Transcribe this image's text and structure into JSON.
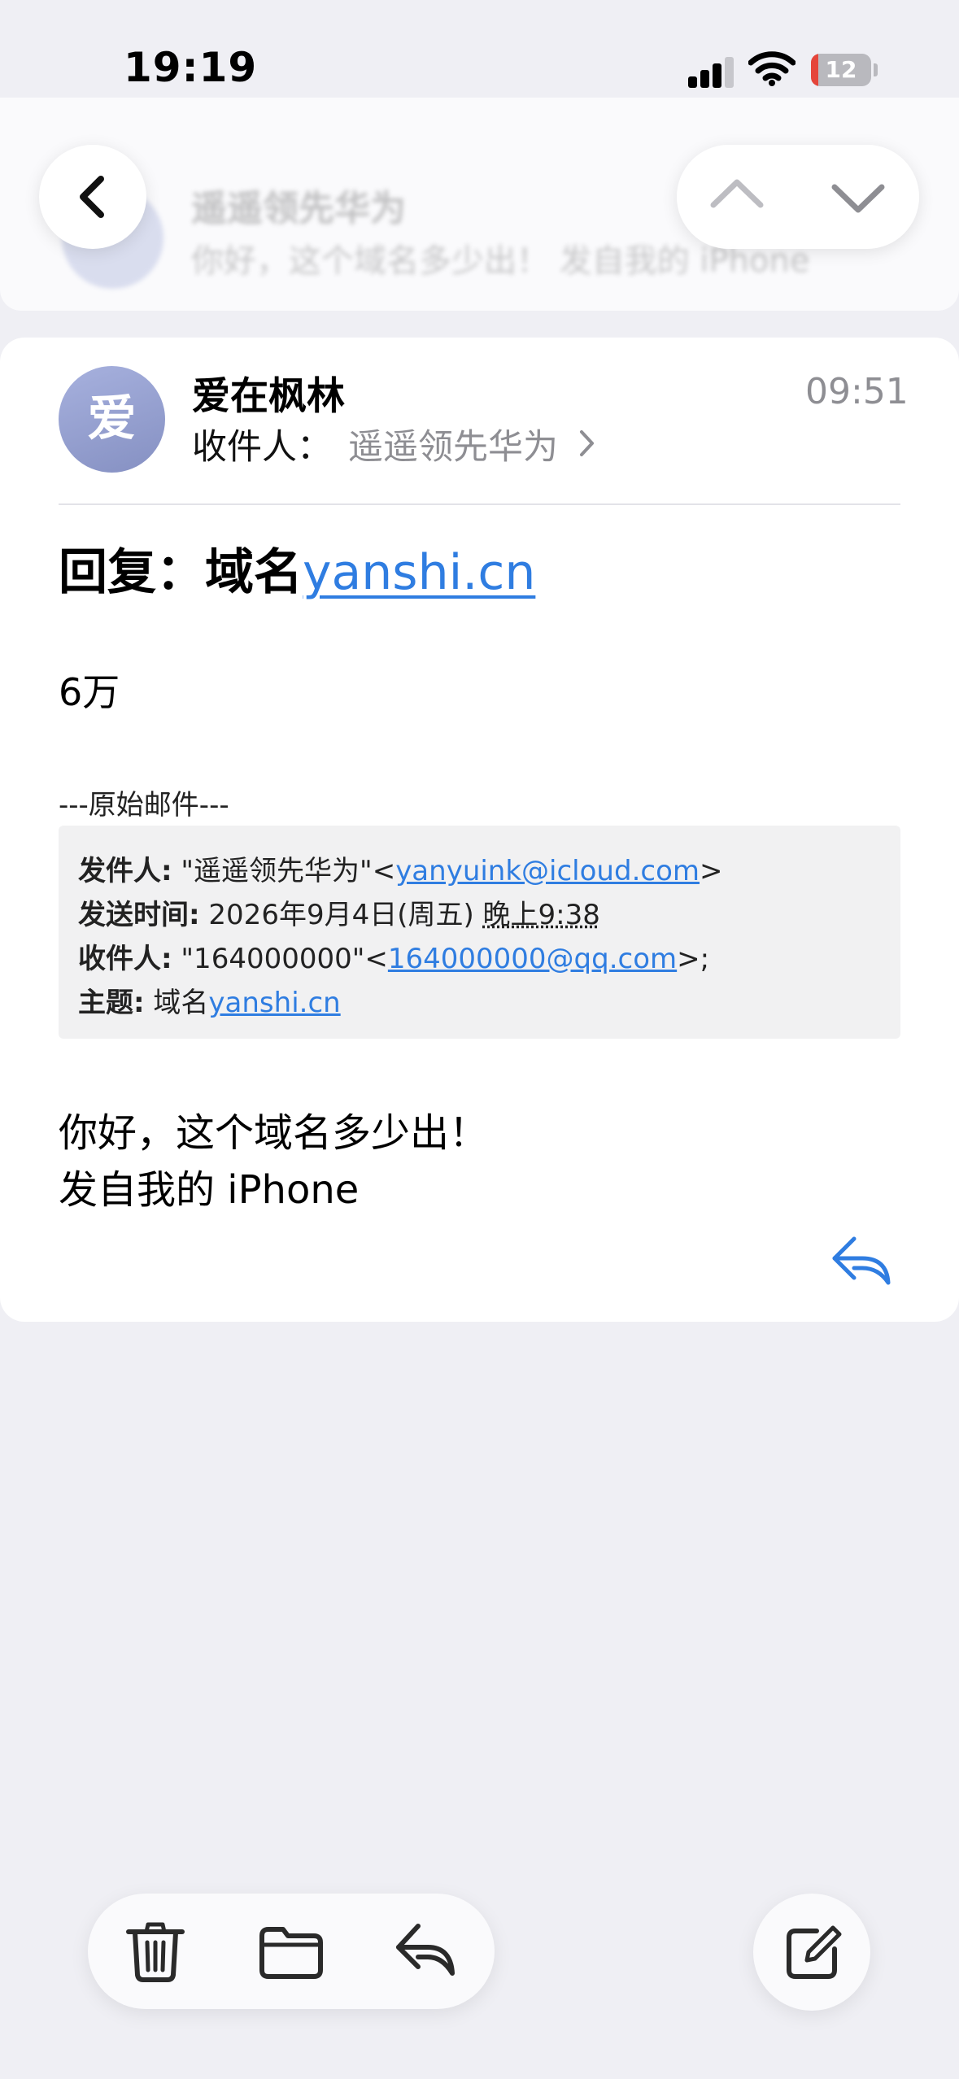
{
  "status_bar": {
    "time": "19:19",
    "battery_percent": 12
  },
  "navigation": {
    "back_icon": "chevron-left-icon",
    "prev_icon": "chevron-up-icon",
    "next_icon": "chevron-down-icon"
  },
  "previous_message": {
    "from": "遥遥领先华为",
    "snippet": "你好，这个域名多少出！ 发自我的 iPhone"
  },
  "message": {
    "avatar_initial": "爱",
    "sender": "爱在枫林",
    "to_label": "收件人：",
    "to_name": "遥遥领先华为",
    "time": "09:51",
    "subject_prefix": "回复：域名",
    "subject_link": "yanshi.cn",
    "body_price": "6万",
    "original_separator": "---原始邮件---",
    "quoted": {
      "from_label": "发件人:",
      "from_name": " \"遥遥领先华为\"<",
      "from_email": "yanyuink@icloud.com",
      "from_close": ">",
      "sent_label": "发送时间:",
      "sent_value_a": " 2026年9月4日(周五) ",
      "sent_value_b": "晚上9:38",
      "to_label": "收件人:",
      "to_name": " \"164000000\"<",
      "to_email": "164000000@qq.com",
      "to_close": ">;",
      "subject_label": "主题:",
      "subject_text": " 域名",
      "subject_link": "yanshi.cn"
    },
    "body_line1": "你好，这个域名多少出！",
    "body_line2": "发自我的 iPhone"
  },
  "toolbar": {
    "items": [
      "trash-icon",
      "folder-icon",
      "reply-icon"
    ],
    "compose": "compose-icon"
  },
  "colors": {
    "accent": "#2f7de1",
    "background": "#efeff4",
    "battery_low": "#e5453a"
  }
}
